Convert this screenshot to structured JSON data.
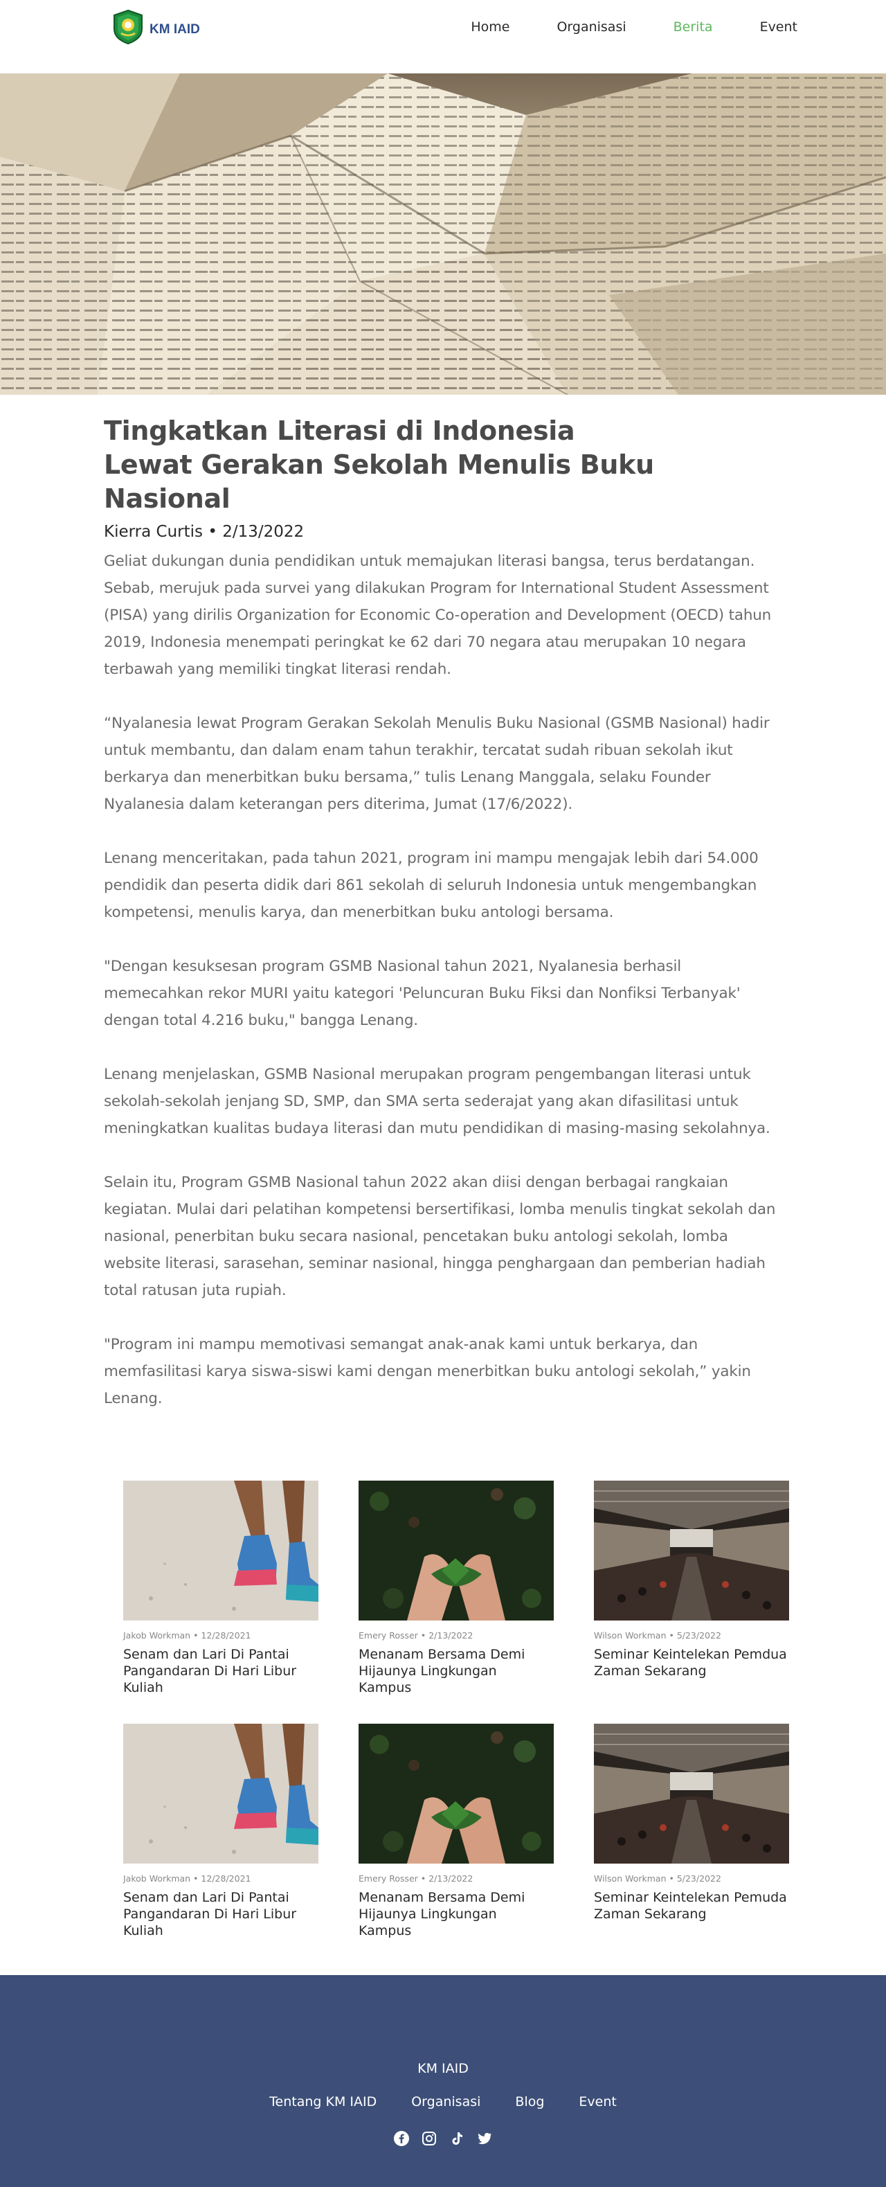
{
  "nav": {
    "brand": "KM IAID",
    "links": [
      "Home",
      "Organisasi",
      "Berita",
      "Event"
    ],
    "active": "Berita",
    "accent_color": "#5cb85c"
  },
  "hero": {
    "image": "crumpled-book-pages"
  },
  "article": {
    "title": "Tingkatkan Literasi di Indonesia Lewat Gerakan Sekolah Menulis Buku Nasional",
    "meta": "Kierra Curtis • 2/13/2022",
    "paragraphs": [
      "Geliat dukungan dunia pendidikan untuk memajukan literasi bangsa, terus berdatangan. Sebab, merujuk pada survei yang dilakukan Program for International Student Assessment (PISA) yang dirilis Organization for Economic Co-operation and Development (OECD) tahun 2019, Indonesia menempati peringkat ke 62 dari 70 negara atau merupakan 10 negara terbawah yang memiliki tingkat literasi rendah.",
      "“Nyalanesia lewat Program Gerakan Sekolah Menulis Buku Nasional (GSMB Nasional) hadir untuk membantu, dan dalam enam tahun terakhir, tercatat sudah ribuan sekolah ikut berkarya dan menerbitkan buku bersama,” tulis Lenang Manggala, selaku Founder Nyalanesia dalam keterangan pers diterima, Jumat (17/6/2022).",
      "Lenang menceritakan, pada tahun 2021, program ini mampu mengajak lebih dari 54.000 pendidik dan peserta didik dari 861 sekolah di seluruh Indonesia untuk mengembangkan kompetensi, menulis karya, dan menerbitkan buku antologi bersama.",
      "\"Dengan kesuksesan program GSMB Nasional tahun 2021, Nyalanesia berhasil memecahkan rekor MURI yaitu kategori 'Peluncuran Buku Fiksi dan Nonfiksi Terbanyak' dengan total 4.216 buku,\" bangga Lenang.",
      "Lenang menjelaskan, GSMB Nasional merupakan program pengembangan literasi untuk sekolah-sekolah jenjang SD, SMP, dan SMA serta sederajat yang akan difasilitasi untuk meningkatkan kualitas budaya literasi dan mutu pendidikan di masing-masing sekolahnya.",
      "Selain itu, Program GSMB Nasional tahun 2022 akan diisi dengan berbagai rangkaian kegiatan. Mulai dari pelatihan kompetensi bersertifikasi, lomba menulis tingkat sekolah dan nasional, penerbitan buku secara nasional, pencetakan buku antologi sekolah, lomba website literasi, sarasehan, seminar nasional, hingga penghargaan dan pemberian hadiah total ratusan juta rupiah.",
      "\"Program ini mampu memotivasi semangat anak-anak kami untuk berkarya, dan memfasilitasi karya siswa-siswi kami dengan menerbitkan buku antologi sekolah,” yakin Lenang."
    ]
  },
  "cards": [
    {
      "meta": "Jakob Workman • 12/28/2021",
      "title": "Senam dan Lari Di Pantai Pangandaran Di Hari Libur Kuliah",
      "image": "running-sand"
    },
    {
      "meta": "Emery Rosser • 2/13/2022",
      "title": "Menanam Bersama Demi Hijaunya Lingkungan Kampus",
      "image": "hands-plant"
    },
    {
      "meta": "Wilson Workman • 5/23/2022",
      "title": "Seminar Keintelekan Pemdua Zaman Sekarang",
      "image": "seminar-hall"
    },
    {
      "meta": "Jakob Workman • 12/28/2021",
      "title": "Senam dan Lari Di Pantai Pangandaran Di Hari Libur Kuliah",
      "image": "running-sand"
    },
    {
      "meta": "Emery Rosser • 2/13/2022",
      "title": "Menanam Bersama Demi Hijaunya Lingkungan Kampus",
      "image": "hands-plant"
    },
    {
      "meta": "Wilson Workman • 5/23/2022",
      "title": "Seminar Keintelekan Pemuda Zaman Sekarang",
      "image": "seminar-hall"
    }
  ],
  "footer": {
    "brand": "KM IAID",
    "links": [
      "Tentang KM IAID",
      "Organisasi",
      "Blog",
      "Event"
    ],
    "social": [
      "facebook-icon",
      "instagram-icon",
      "tiktok-icon",
      "twitter-icon"
    ],
    "background": "#3d4f78"
  }
}
